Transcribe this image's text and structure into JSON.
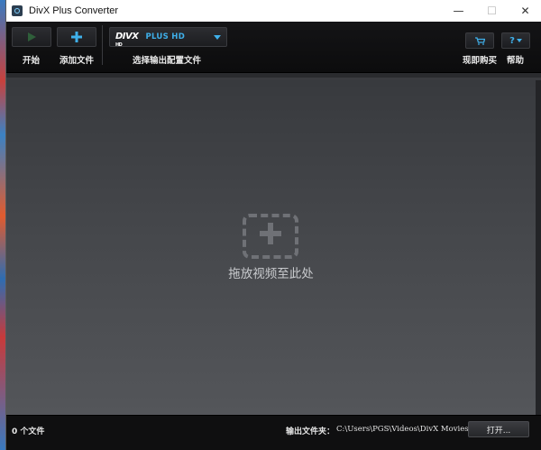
{
  "window": {
    "title": "DivX Plus Converter",
    "minimize": "—",
    "maximize": "☐",
    "close": "✕"
  },
  "toolbar": {
    "start_label": "开始",
    "add_file_label": "添加文件",
    "profile_label": "选择输出配置文件",
    "profile_logo": "DIVX",
    "profile_logo_sub": "HD",
    "profile_selected": "PLUS HD",
    "buy_label": "现即购买",
    "help_label": "帮助",
    "help_glyph": "?"
  },
  "drop_area": {
    "text": "拖放视频至此处"
  },
  "status": {
    "count": "0 个文件",
    "output_label": "输出文件夹：",
    "output_path": "C:\\Users\\PGS\\Videos\\DivX Movies",
    "open_label": "打开..."
  },
  "colors": {
    "accent": "#3fb0ea",
    "background": "#1d1e21"
  }
}
